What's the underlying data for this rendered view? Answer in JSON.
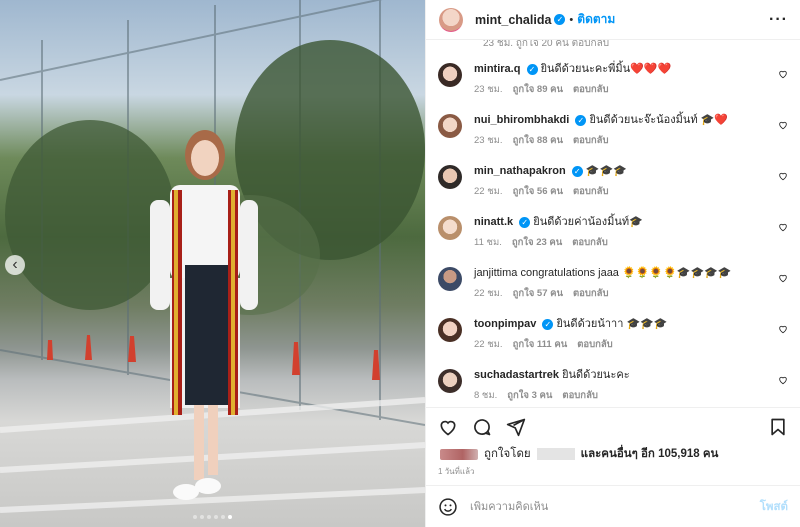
{
  "post": {
    "author": "mint_chalida",
    "follow_label": "ติดตาม",
    "separator": "•",
    "more_glyph": "···",
    "carousel_prev_glyph": "‹"
  },
  "icons": {
    "heart": "heart-icon",
    "comment": "comment-icon",
    "share": "share-icon",
    "save": "bookmark-icon",
    "emoji": "emoji-icon"
  },
  "colors": {
    "accent": "#0095f6",
    "heart": "#ed4956",
    "muted": "#8e8e8e"
  },
  "partial_comment_meta": "23 ชม.   ถูกใจ 20 คน   ตอบกลับ",
  "comments": [
    {
      "user": "mintira.q",
      "verified": true,
      "text": "ยินดีด้วยนะคะพี่มิ้น❤️❤️❤️",
      "time": "23 ชม.",
      "likes": "ถูกใจ 89 คน",
      "reply": "ตอบกลับ"
    },
    {
      "user": "nui_bhirombhakdi",
      "verified": true,
      "text": "ยินดีด้วยนะจ๊ะน้องมิ้นท์ 🎓❤️",
      "time": "23 ชม.",
      "likes": "ถูกใจ 88 คน",
      "reply": "ตอบกลับ"
    },
    {
      "user": "min_nathapakron",
      "verified": true,
      "text": "🎓🎓🎓",
      "time": "22 ชม.",
      "likes": "ถูกใจ 56 คน",
      "reply": "ตอบกลับ"
    },
    {
      "user": "ninatt.k",
      "verified": true,
      "text": "ยินดีด้วยค่าน้องมิ้นท์🎓",
      "time": "11 ชม.",
      "likes": "ถูกใจ 23 คน",
      "reply": "ตอบกลับ"
    },
    {
      "user": "janjittima",
      "verified": false,
      "text": "congratulations jaaa 🌻🌻🌻🌻🎓🎓🎓🎓",
      "time": "22 ชม.",
      "likes": "ถูกใจ 57 คน",
      "reply": "ตอบกลับ"
    },
    {
      "user": "toonpimpav",
      "verified": true,
      "text": "ยินดีด้วยน้าาา 🎓🎓🎓",
      "time": "22 ชม.",
      "likes": "ถูกใจ 111 คน",
      "reply": "ตอบกลับ"
    },
    {
      "user": "suchadastartrek",
      "verified": false,
      "text": "ยินดีด้วยนะคะ",
      "time": "8 ชม.",
      "likes": "ถูกใจ 3 คน",
      "reply": "ตอบกลับ"
    }
  ],
  "likes_summary": {
    "liked_by": "ถูกใจโดย",
    "and_others": "และคนอื่นๆ อีก 105,918 คน"
  },
  "posted_time": "1 วันที่แล้ว",
  "add_comment": {
    "placeholder": "เพิ่มความคิดเห็น",
    "post_label": "โพสต์"
  },
  "carousel": {
    "count": 6,
    "active_index": 5
  }
}
